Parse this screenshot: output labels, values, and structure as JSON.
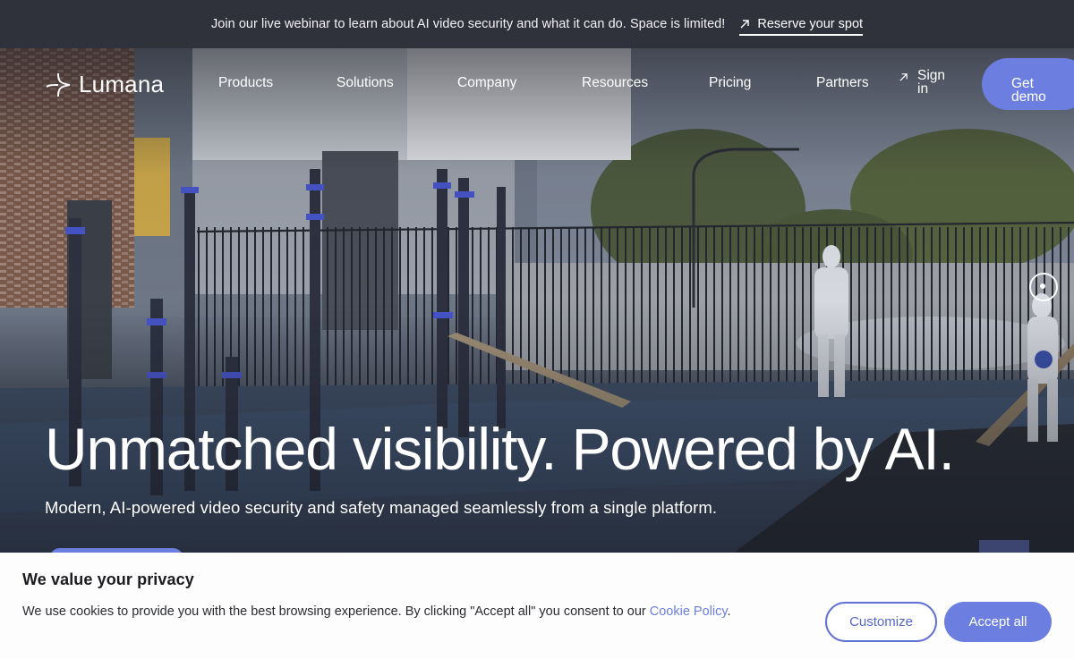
{
  "announcement": {
    "message": "Join our live webinar to learn about AI video security and what it can do. Space is limited!",
    "cta_label": "Reserve your spot",
    "cta_icon": "arrow-up-right-icon"
  },
  "nav": {
    "logo_text": "Lumana",
    "logo_icon": "sparkle-icon",
    "items": [
      {
        "label": "Products"
      },
      {
        "label": "Solutions"
      },
      {
        "label": "Company"
      },
      {
        "label": "Resources"
      },
      {
        "label": "Pricing"
      },
      {
        "label": "Partners"
      }
    ],
    "sign_in_line1": "Sign",
    "sign_in_line2": "in",
    "sign_in_icon": "arrow-up-right-icon",
    "get_demo_line1": "Get",
    "get_demo_line2": "demo"
  },
  "hero": {
    "headline": "Unmatched visibility. Powered by AI.",
    "subheadline": "Modern, AI-powered video security and safety managed seamlessly from a single platform."
  },
  "cookie_banner": {
    "title": "We value your privacy",
    "text": "We use cookies to provide you with the best browsing experience. By clicking \"Accept all\" you consent to our ",
    "link_label": "Cookie Policy",
    "text_end": ".",
    "customize_label": "Customize",
    "accept_label": "Accept all"
  },
  "colors": {
    "accent": "#6c7fe0",
    "announcement_bg": "#2f313b",
    "banner_bg": "#fdfdfe"
  }
}
